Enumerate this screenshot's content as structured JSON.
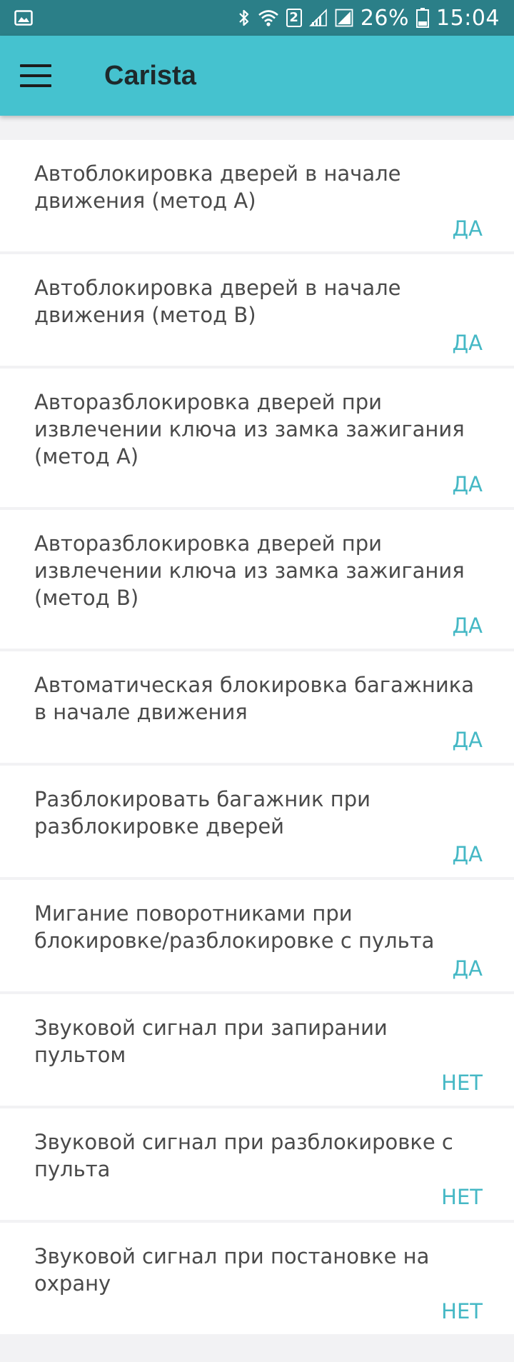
{
  "status_bar": {
    "sim_slot": "2",
    "battery": "26%",
    "time": "15:04"
  },
  "app_bar": {
    "title": "Carista"
  },
  "settings": [
    {
      "label": "Автоблокировка дверей в начале движения (метод A)",
      "value": "ДА"
    },
    {
      "label": "Автоблокировка дверей в начале движения (метод B)",
      "value": "ДА"
    },
    {
      "label": "Авторазблокировка дверей при извлечении ключа из замка зажигания (метод A)",
      "value": "ДА"
    },
    {
      "label": "Авторазблокировка дверей при извлечении ключа из замка зажигания (метод B)",
      "value": "ДА"
    },
    {
      "label": "Автоматическая блокировка багажника в начале движения",
      "value": "ДА"
    },
    {
      "label": "Разблокировать багажник при разблокировке дверей",
      "value": "ДА"
    },
    {
      "label": "Мигание поворотниками при блокировке/разблокировке с пульта",
      "value": "ДА"
    },
    {
      "label": "Звуковой сигнал при запирании пультом",
      "value": "НЕТ"
    },
    {
      "label": "Звуковой сигнал при разблокировке с пульта",
      "value": "НЕТ"
    },
    {
      "label": "Звуковой сигнал при постановке на охрану",
      "value": "НЕТ"
    }
  ],
  "colors": {
    "status_bar": "#2b7f88",
    "app_bar": "#45c2cf",
    "accent_value": "#45b8c5",
    "background": "#f2f2f4"
  }
}
